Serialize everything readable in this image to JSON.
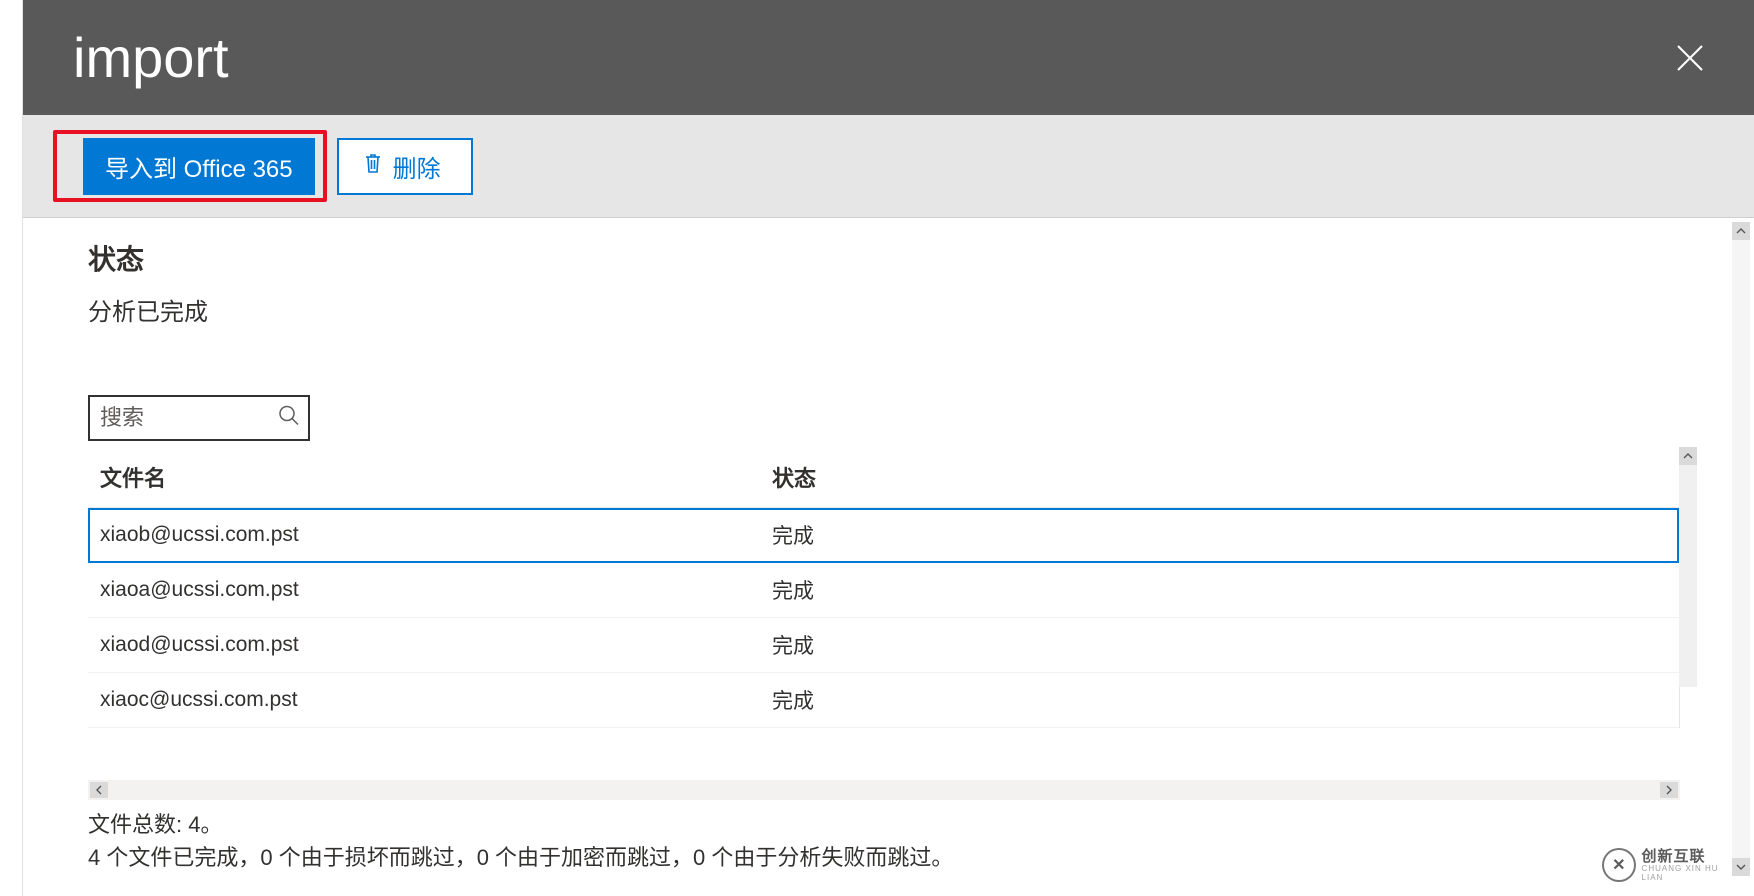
{
  "header": {
    "title": "import"
  },
  "toolbar": {
    "import_label": "导入到 Office 365",
    "delete_label": "删除"
  },
  "status": {
    "heading": "状态",
    "text": "分析已完成"
  },
  "search": {
    "placeholder": "搜索"
  },
  "columns": {
    "filename": "文件名",
    "state": "状态"
  },
  "rows": [
    {
      "filename": "xiaob@ucssi.com.pst",
      "state": "完成",
      "selected": true
    },
    {
      "filename": "xiaoa@ucssi.com.pst",
      "state": "完成",
      "selected": false
    },
    {
      "filename": "xiaod@ucssi.com.pst",
      "state": "完成",
      "selected": false
    },
    {
      "filename": "xiaoc@ucssi.com.pst",
      "state": "完成",
      "selected": false
    }
  ],
  "summary": {
    "total_label": "文件总数: 4。",
    "detail": "4 个文件已完成，0 个由于损坏而跳过，0 个由于加密而跳过，0 个由于分析失败而跳过。"
  },
  "watermark": {
    "text": "创新互联"
  }
}
